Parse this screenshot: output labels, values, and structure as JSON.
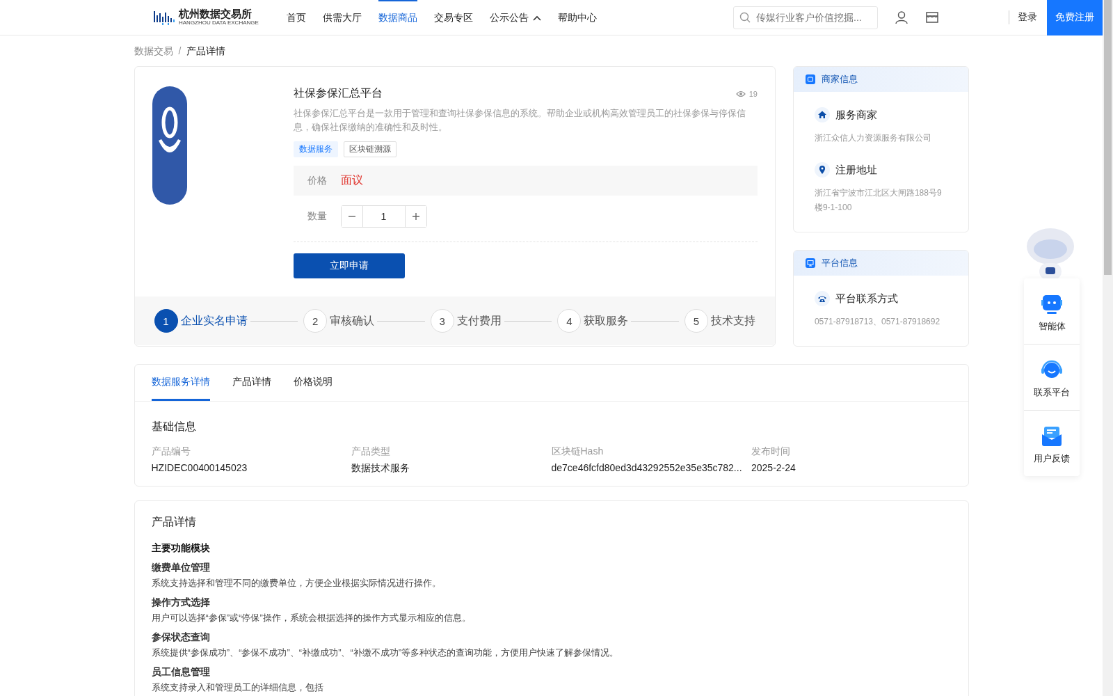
{
  "header": {
    "logo": {
      "name": "杭州数据交易所",
      "subtitle": "HANGZHOU DATA EXCHANGE"
    },
    "nav": [
      {
        "label": "首页",
        "selected": false,
        "kind": "link"
      },
      {
        "label": "供需大厅",
        "selected": false,
        "kind": "link"
      },
      {
        "label": "数据商品",
        "selected": true,
        "kind": "link"
      },
      {
        "label": "交易专区",
        "selected": false,
        "kind": "link"
      },
      {
        "label": "公示公告",
        "selected": false,
        "kind": "dropdown"
      },
      {
        "label": "帮助中心",
        "selected": false,
        "kind": "link"
      }
    ],
    "search": {
      "placeholder": "传媒行业客户价值挖掘..."
    },
    "login": "登录",
    "register": "免费注册"
  },
  "breadcrumb": {
    "separator": "/",
    "items": [
      "数据交易",
      "产品详情"
    ]
  },
  "product": {
    "title": "社保参保汇总平台",
    "views": "19",
    "description": "社保参保汇总平台是一款用于管理和查询社保参保信息的系统。帮助企业或机构高效管理员工的社保参保与停保信息，确保社保缴纳的准确性和及时性。",
    "tags": [
      {
        "label": "数据服务",
        "kind": "primary"
      },
      {
        "label": "区块链溯源",
        "kind": "outline"
      }
    ],
    "price_label": "价格",
    "price": "面议",
    "quantity_label": "数量",
    "quantity": "1",
    "apply_button": "立即申请"
  },
  "steps": [
    {
      "number": "1",
      "label": "企业实名申请",
      "selected": true
    },
    {
      "number": "2",
      "label": "审核确认",
      "selected": false
    },
    {
      "number": "3",
      "label": "支付费用",
      "selected": false
    },
    {
      "number": "4",
      "label": "获取服务",
      "selected": false
    },
    {
      "number": "5",
      "label": "技术支持",
      "selected": false
    }
  ],
  "merchant_info": {
    "title": "商家信息",
    "items": [
      {
        "kind": "home",
        "label": "服务商家",
        "value": "浙江众信人力资源服务有限公司"
      },
      {
        "kind": "location",
        "label": "注册地址",
        "value": "浙江省宁波市江北区大闸路188号9楼9-1-100"
      }
    ]
  },
  "platform_info": {
    "title": "平台信息",
    "items": [
      {
        "kind": "phone",
        "label": "平台联系方式",
        "value": "0571-87918713、0571-87918692"
      }
    ]
  },
  "tabs": [
    {
      "label": "数据服务详情",
      "selected": true
    },
    {
      "label": "产品详情",
      "selected": false
    },
    {
      "label": "价格说明",
      "selected": false
    }
  ],
  "basic_info": {
    "title": "基础信息",
    "fields": [
      {
        "label": "产品编号",
        "value": "HZIDEC00400145023"
      },
      {
        "label": "产品类型",
        "value": "数据技术服务"
      },
      {
        "label": "区块链Hash",
        "value": "de7ce46fcfd80ed3d43292552e35e35c782..."
      },
      {
        "label": "发布时间",
        "value": "2025-2-24"
      }
    ]
  },
  "product_details": {
    "title": "产品详情",
    "section_title": "主要功能模块",
    "items": [
      {
        "title": "缴费单位管理",
        "text": "系统支持选择和管理不同的缴费单位，方便企业根据实际情况进行操作。"
      },
      {
        "title": "操作方式选择",
        "text": "用户可以选择“参保”或“停保”操作，系统会根据选择的操作方式显示相应的信息。"
      },
      {
        "title": "参保状态查询",
        "text": "系统提供“参保成功”、“参保不成功”、“补缴成功”、“补缴不成功”等多种状态的查询功能，方便用户快速了解参保情况。"
      },
      {
        "title": "员工信息管理",
        "text": "系统支持录入和管理员工的详细信息，包括"
      }
    ]
  },
  "float_panel": [
    {
      "kind": "agent",
      "label": "智能体"
    },
    {
      "kind": "contact",
      "label": "联系平台"
    },
    {
      "kind": "feedback",
      "label": "用户反馈"
    }
  ]
}
